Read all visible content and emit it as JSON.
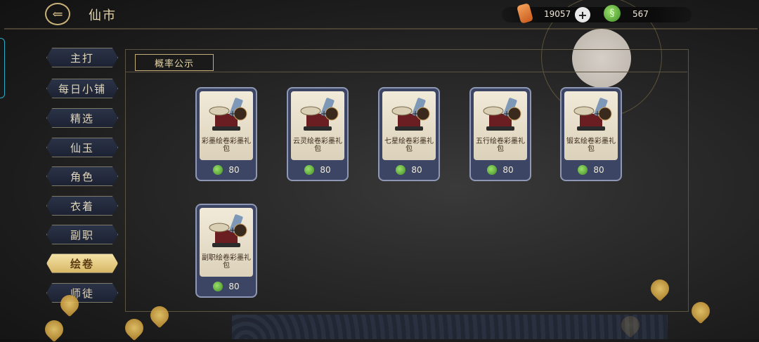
{
  "header": {
    "back_icon": "back-arrow-icon",
    "title": "仙市"
  },
  "currencies": [
    {
      "name": "crystal",
      "icon": "orange-crystal-icon",
      "value": "19057"
    },
    {
      "name": "jade",
      "icon": "green-jade-icon",
      "value": "567"
    }
  ],
  "sidebar": {
    "items": [
      {
        "label": "主打",
        "active": false
      },
      {
        "label": "每日小铺",
        "active": false
      },
      {
        "label": "精选",
        "active": false
      },
      {
        "label": "仙玉",
        "active": false
      },
      {
        "label": "角色",
        "active": false
      },
      {
        "label": "衣着",
        "active": false
      },
      {
        "label": "副职",
        "active": false
      },
      {
        "label": "绘卷",
        "active": true
      },
      {
        "label": "师徒",
        "active": false
      }
    ]
  },
  "main": {
    "probability_button": "概率公示",
    "items": [
      {
        "name": "彩墨绘卷彩墨礼包",
        "price": "80",
        "currency": "jade"
      },
      {
        "name": "云灵绘卷彩墨礼包",
        "price": "80",
        "currency": "jade"
      },
      {
        "name": "七星绘卷彩墨礼包",
        "price": "80",
        "currency": "jade"
      },
      {
        "name": "五行绘卷彩墨礼包",
        "price": "80",
        "currency": "jade"
      },
      {
        "name": "锻玄绘卷彩墨礼包",
        "price": "80",
        "currency": "jade"
      },
      {
        "name": "副职绘卷彩墨礼包",
        "price": "80",
        "currency": "jade"
      }
    ]
  },
  "colors": {
    "accent_gold": "#d8b766",
    "tab_blue": "#2b3348",
    "card_blue": "#3c4664",
    "jade_green": "#5fb038"
  }
}
